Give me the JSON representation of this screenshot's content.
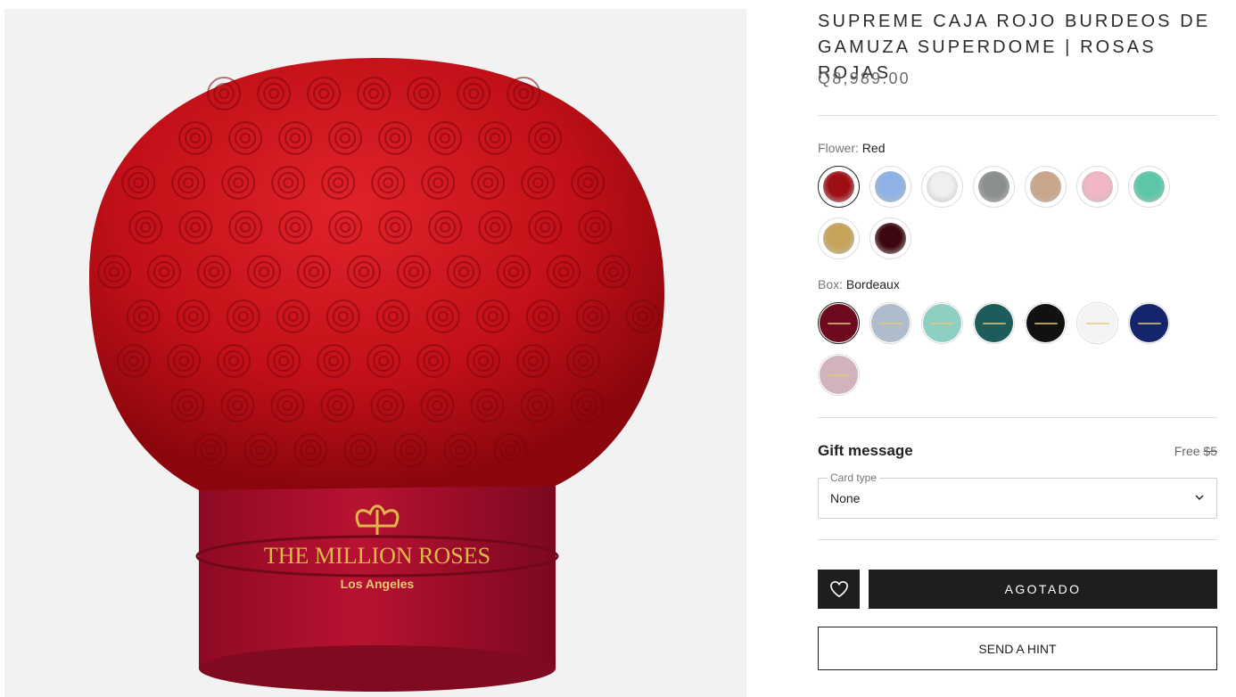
{
  "product": {
    "title": "SUPREME CAJA ROJO BURDEOS DE GAMUZA SUPERDOME | ROSAS ROJAS",
    "price": "Q8,989.00",
    "image": {
      "brand_line": "THE MILLION ROSES",
      "brand_sub": "Los Angeles",
      "colors": {
        "roses": "#c8101a",
        "box": "#a80f2c",
        "logo": "#e0b84a",
        "background": "#f2f2f2"
      }
    }
  },
  "flower_option": {
    "label": "Flower:",
    "selected": "Red",
    "swatches": [
      {
        "name": "Red",
        "color": "#9e0f14"
      },
      {
        "name": "Light Blue",
        "color": "#8fb2e6"
      },
      {
        "name": "White",
        "color": "#efefef"
      },
      {
        "name": "Gray",
        "color": "#8a8e8c"
      },
      {
        "name": "Champagne",
        "color": "#c9a58a"
      },
      {
        "name": "Pink",
        "color": "#f2b6c6"
      },
      {
        "name": "Mint",
        "color": "#5cc7a8"
      },
      {
        "name": "Gold",
        "color": "#c8a35a"
      },
      {
        "name": "Black Rose",
        "color": "#3d0710"
      }
    ]
  },
  "box_option": {
    "label": "Box:",
    "selected": "Bordeaux",
    "swatches": [
      {
        "name": "Bordeaux",
        "color": "#6e0a1e"
      },
      {
        "name": "Light Gray Blue",
        "color": "#aebccb"
      },
      {
        "name": "Mint",
        "color": "#8fcfc3"
      },
      {
        "name": "Teal",
        "color": "#1e5c5c"
      },
      {
        "name": "Black",
        "color": "#111111"
      },
      {
        "name": "White",
        "color": "#f3f3f3"
      },
      {
        "name": "Navy",
        "color": "#14256b"
      },
      {
        "name": "Light Pink",
        "color": "#d1b3bf"
      }
    ]
  },
  "gift": {
    "title": "Gift message",
    "price_free": "Free",
    "price_old": "$5",
    "card_type_label": "Card type",
    "card_type_value": "None"
  },
  "actions": {
    "soldout_label": "AGOTADO",
    "hint_label": "SEND A HINT"
  }
}
